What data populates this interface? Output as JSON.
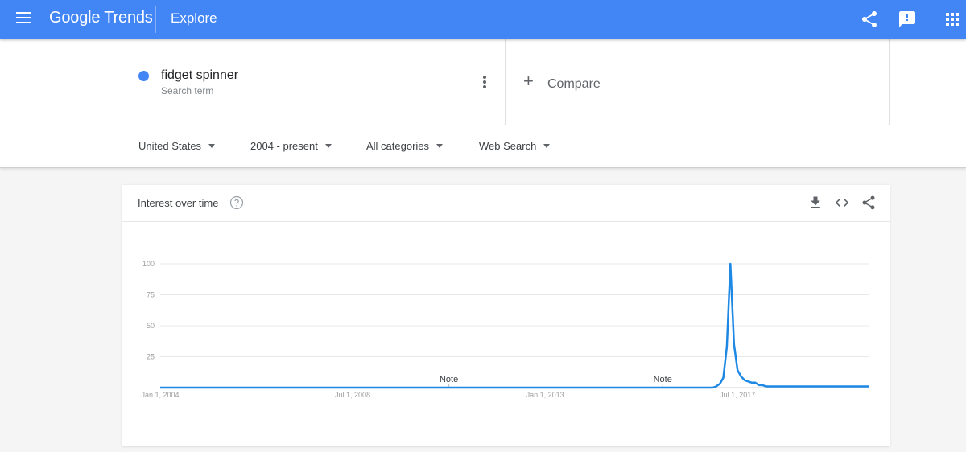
{
  "header": {
    "logo_google": "Google",
    "logo_trends": "Trends",
    "section": "Explore",
    "icons": [
      "menu-icon",
      "share-icon",
      "feedback-icon",
      "apps-icon"
    ]
  },
  "search_term": {
    "name": "fidget spinner",
    "type": "Search term",
    "color": "#4285f4"
  },
  "compare": {
    "plus": "+",
    "label": "Compare"
  },
  "filters": {
    "location": "United States",
    "time": "2004 - present",
    "category": "All categories",
    "property": "Web Search"
  },
  "interest_card": {
    "title": "Interest over time",
    "icons": [
      "help-icon",
      "download-icon",
      "embed-icon",
      "share-icon"
    ]
  },
  "chart_data": {
    "type": "line",
    "title": "Interest over time",
    "series": [
      {
        "name": "fidget spinner",
        "color": "#1e88e5",
        "x": [
          "2004-01",
          "2008-07",
          "2013-01",
          "2016-06",
          "2016-12",
          "2017-01",
          "2017-02",
          "2017-03",
          "2017-04",
          "2017-05",
          "2017-06",
          "2017-07",
          "2017-08",
          "2017-09",
          "2017-10",
          "2017-11",
          "2017-12",
          "2018-01",
          "2018-02",
          "2018-03",
          "2018-04",
          "2018-06",
          "2019-01",
          "2019-06",
          "2020-01",
          "2020-08"
        ],
        "values": [
          0,
          0,
          0,
          0,
          0,
          1,
          3,
          8,
          33,
          100,
          35,
          14,
          9,
          6,
          5,
          4,
          4,
          2,
          2,
          1,
          1,
          1,
          1,
          1,
          1,
          1
        ]
      }
    ],
    "ylim": [
      0,
      100
    ],
    "ytick_labels": [
      "100",
      "75",
      "50",
      "25"
    ],
    "yticks": [
      100,
      75,
      50,
      25
    ],
    "xtick_labels": [
      "Jan 1, 2004",
      "Jul 1, 2008",
      "Jan 1, 2013",
      "Jul 1, 2017"
    ],
    "xticks": [
      "2004-01",
      "2008-07",
      "2013-01",
      "2017-07"
    ],
    "annotations": [
      {
        "text": "Note",
        "x": "2010-10"
      },
      {
        "text": "Note",
        "x": "2015-10"
      }
    ],
    "grid": true,
    "legend": "none"
  }
}
